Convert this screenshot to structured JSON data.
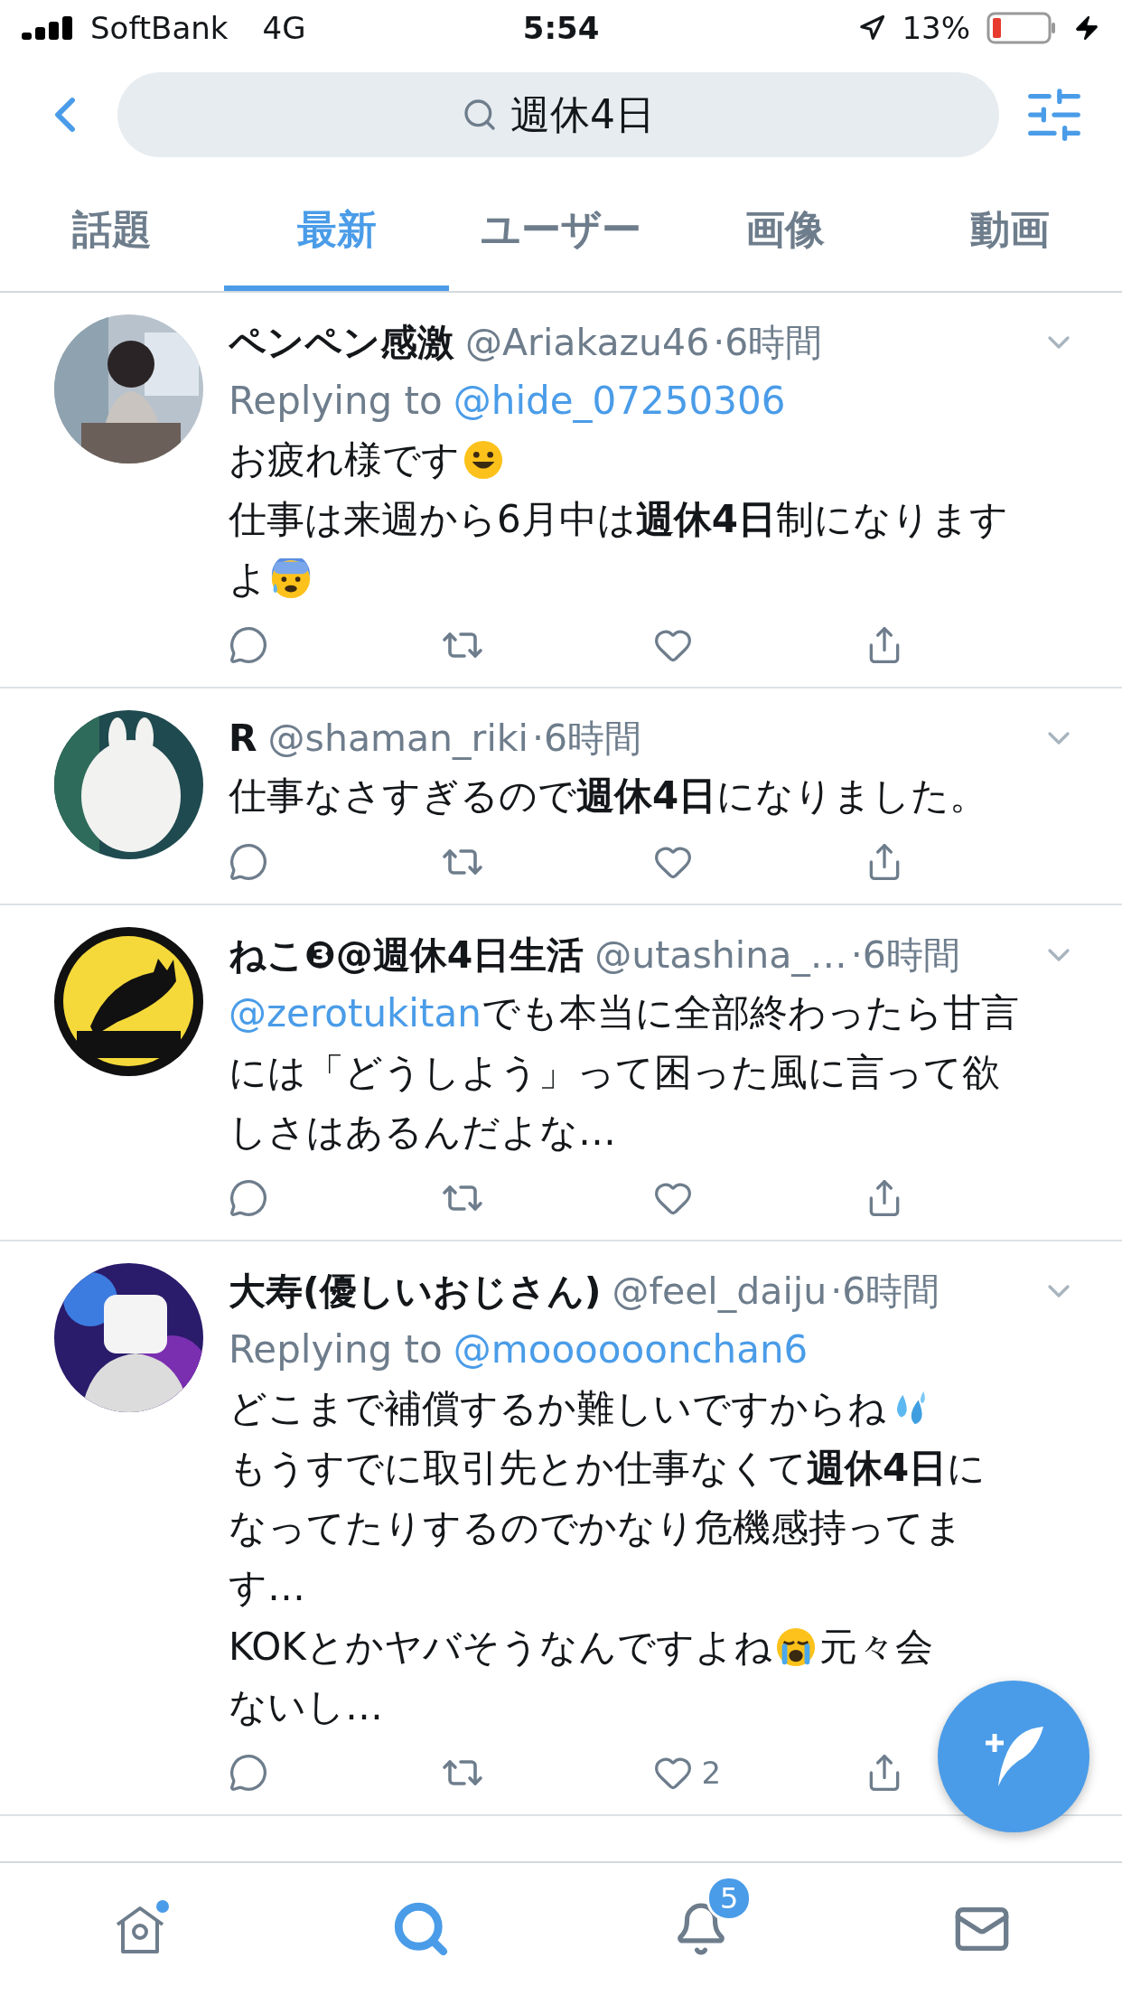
{
  "status_bar": {
    "carrier": "SoftBank",
    "network": "4G",
    "time": "5:54",
    "battery": "13%"
  },
  "search": {
    "value": "週休4日"
  },
  "tabs": [
    {
      "label": "話題",
      "selected": false
    },
    {
      "label": "最新",
      "selected": true
    },
    {
      "label": "ユーザー",
      "selected": false
    },
    {
      "label": "画像",
      "selected": false
    },
    {
      "label": "動画",
      "selected": false
    }
  ],
  "tweets": [
    {
      "name": "ペンペン感激",
      "handle": "@Ariakazu46",
      "time": "·6時間",
      "replying_to": {
        "label": "Replying to",
        "mention": "@hide_07250306"
      },
      "lines": [
        [
          {
            "kind": "text",
            "text": "お疲れ様です"
          },
          {
            "kind": "emoji"
          }
        ],
        [
          {
            "kind": "text",
            "text": "仕事は来週から6月中は**週休4日**制になります"
          }
        ],
        [
          {
            "kind": "text",
            "text": "よ"
          },
          {
            "kind": "emoji"
          }
        ]
      ]
    },
    {
      "name": "R",
      "handle": "@shaman_riki",
      "time": "·6時間",
      "lines": [
        [
          {
            "kind": "text",
            "text": "仕事なさすぎるので**週休4日**になりました。"
          }
        ]
      ]
    },
    {
      "name": "ねこ❸@週休4日生活",
      "handle": "@utashina_…",
      "time": "·6時間",
      "lines": [
        [
          {
            "kind": "mention",
            "text": "@zerotukitan"
          },
          {
            "kind": "text",
            "text": " でも本当に全部終わったら甘言"
          }
        ],
        [
          {
            "kind": "text",
            "text": "には「どうしよう」って困った風に言って欲"
          }
        ],
        [
          {
            "kind": "text",
            "text": "しさはあるんだよな…"
          }
        ]
      ]
    },
    {
      "name": "大寿(優しいおじさん)",
      "handle": "@feel_daiju",
      "time": "·6時間",
      "replying_to": {
        "label": "Replying to",
        "mention": "@moooooonchan6"
      },
      "lines": [
        [
          {
            "kind": "text",
            "text": "どこまで補償するか難しいですからね"
          },
          {
            "kind": "emoji"
          }
        ],
        [
          {
            "kind": "text",
            "text": "もうすでに取引先とか仕事なくて**週休4日**に"
          }
        ],
        [
          {
            "kind": "text",
            "text": "なってたりするのでかなり危機感持ってま"
          }
        ],
        [
          {
            "kind": "text",
            "text": "す…"
          }
        ],
        [
          {
            "kind": "text",
            "text": "KOKとかヤバそうなんですよね"
          },
          {
            "kind": "emoji"
          },
          {
            "kind": "text",
            "text": "元々会"
          }
        ],
        [
          {
            "kind": "text",
            "text": "ないし…"
          }
        ]
      ],
      "likes": "2"
    }
  ],
  "nav": [
    {
      "selected": false
    },
    {
      "selected": true
    },
    {
      "selected": false,
      "badge": "5"
    },
    {
      "selected": false
    }
  ]
}
